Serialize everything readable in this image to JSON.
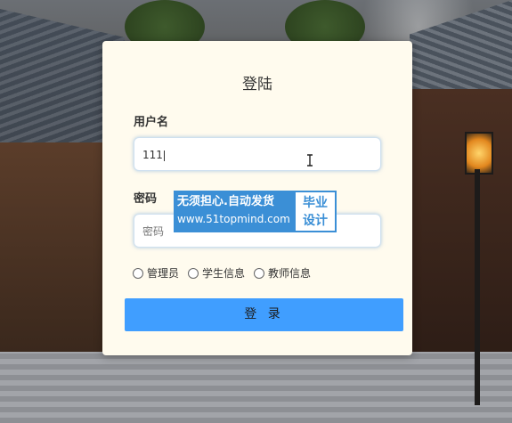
{
  "login": {
    "title": "登陆",
    "username_label": "用户名",
    "username_value": "111",
    "password_label": "密码",
    "password_placeholder": "密码",
    "roles": [
      "管理员",
      "学生信息",
      "教师信息"
    ],
    "submit_label": "登 录"
  },
  "watermark": {
    "line1": "无须担心.自动发货",
    "line2": "www.51topmind.com",
    "badge_line1": "毕业",
    "badge_line2": "设计"
  },
  "colors": {
    "card_bg": "#fffbee",
    "button_bg": "#409eff",
    "watermark_blue": "#3b8fd6"
  }
}
